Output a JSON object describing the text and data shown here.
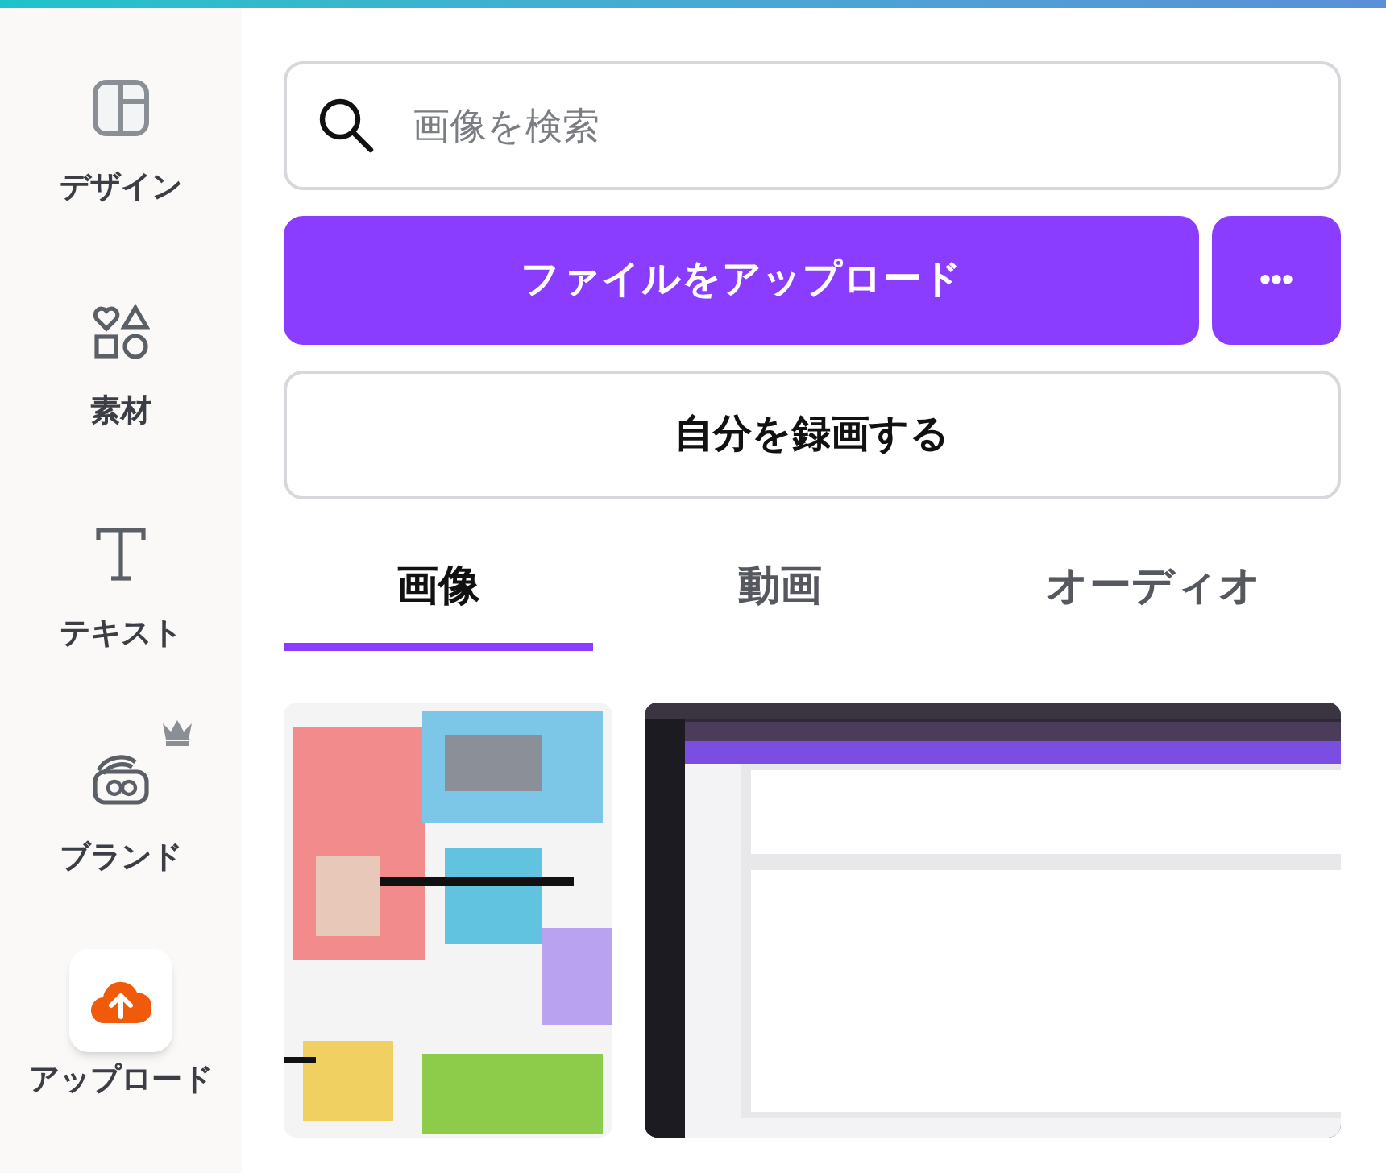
{
  "sidebar": {
    "items": [
      {
        "label": "デザイン",
        "selected": false,
        "premium": false
      },
      {
        "label": "素材",
        "selected": false,
        "premium": false
      },
      {
        "label": "テキスト",
        "selected": false,
        "premium": false
      },
      {
        "label": "ブランド",
        "selected": false,
        "premium": true
      },
      {
        "label": "アップロード",
        "selected": true,
        "premium": false
      }
    ]
  },
  "search": {
    "placeholder": "画像を検索"
  },
  "upload_button": "ファイルをアップロード",
  "more_button": "•••",
  "record_button": "自分を録画する",
  "tabs": [
    {
      "label": "画像",
      "selected": true
    },
    {
      "label": "動画",
      "selected": false
    },
    {
      "label": "オーディオ",
      "selected": false
    }
  ]
}
